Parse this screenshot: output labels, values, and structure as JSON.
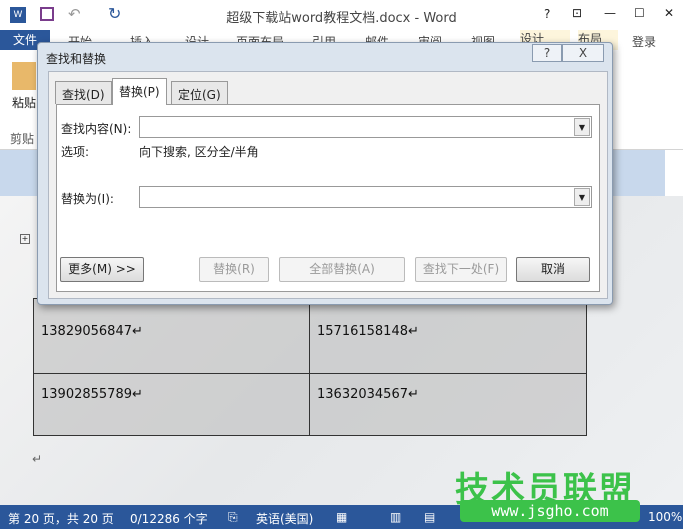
{
  "window": {
    "title": "超级下载站word教程文档.docx - Word",
    "help": "?",
    "restore": "⊡",
    "minimize": "—",
    "maximize": "☐",
    "close": "✕"
  },
  "ribbon": {
    "tabs": [
      "文件",
      "开始",
      "插入",
      "设计",
      "页面布局",
      "引用",
      "邮件",
      "审阅",
      "视图",
      "设计",
      "布局"
    ],
    "login": "登录",
    "paste": "粘贴",
    "clipboard": "剪贴"
  },
  "table": {
    "rows": [
      [
        "13829056847↵",
        "15716158148↵"
      ],
      [
        "13902855789↵",
        "13632034567↵"
      ]
    ]
  },
  "dialog": {
    "title": "查找和替换",
    "help": "?",
    "close": "X",
    "tabs": [
      "查找(D)",
      "替换(P)",
      "定位(G)"
    ],
    "active_tab": 1,
    "find_label": "查找内容(N):",
    "find_value": "",
    "options_label": "选项:",
    "options_value": "向下搜索, 区分全/半角",
    "replace_label": "替换为(I):",
    "replace_value": "",
    "buttons": {
      "more": "更多(M) >>",
      "replace": "替换(R)",
      "replace_all": "全部替换(A)",
      "find_next": "查找下一处(F)",
      "cancel": "取消"
    }
  },
  "status": {
    "page": "第 20 页，共 20 页",
    "words": "0/12286 个字",
    "language": "英语(美国)",
    "zoom": "100%"
  },
  "watermark": {
    "name": "技术员联盟",
    "url": "www.jsgho.com"
  }
}
